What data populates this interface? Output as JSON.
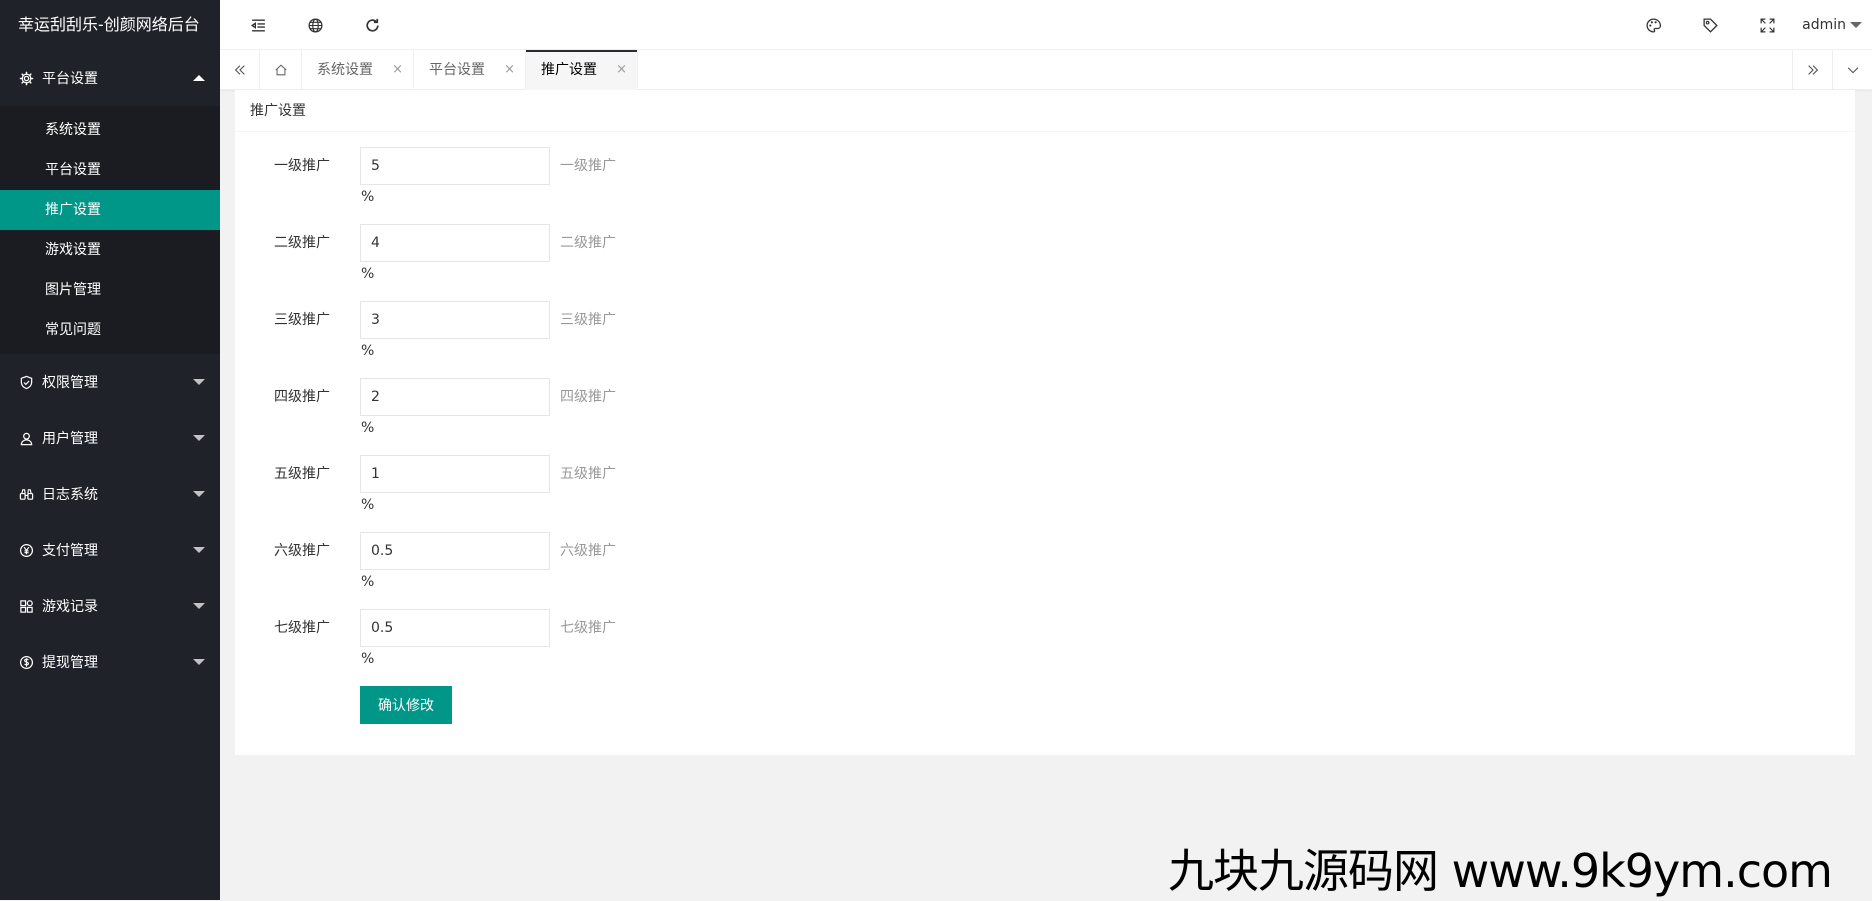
{
  "app_title": "幸运刮刮乐-创颜网络后台",
  "sidebar": {
    "groups": [
      {
        "label": "平台设置",
        "icon": "gear-icon",
        "expanded": true,
        "items": [
          {
            "label": "系统设置"
          },
          {
            "label": "平台设置"
          },
          {
            "label": "推广设置",
            "active": true
          },
          {
            "label": "游戏设置"
          },
          {
            "label": "图片管理"
          },
          {
            "label": "常见问题"
          }
        ]
      },
      {
        "label": "权限管理",
        "icon": "shield-icon"
      },
      {
        "label": "用户管理",
        "icon": "user-icon"
      },
      {
        "label": "日志系统",
        "icon": "binoculars-icon"
      },
      {
        "label": "支付管理",
        "icon": "yen-icon"
      },
      {
        "label": "游戏记录",
        "icon": "apps-icon"
      },
      {
        "label": "提现管理",
        "icon": "dollar-icon"
      }
    ]
  },
  "header": {
    "user": "admin"
  },
  "tabs": [
    {
      "label": "系统设置"
    },
    {
      "label": "平台设置"
    },
    {
      "label": "推广设置",
      "active": true
    }
  ],
  "tab_close_glyph": "×",
  "card": {
    "title": "推广设置",
    "fields": [
      {
        "label": "一级推广",
        "value": "5",
        "tip": "一级推广",
        "unit": "%"
      },
      {
        "label": "二级推广",
        "value": "4",
        "tip": "二级推广",
        "unit": "%"
      },
      {
        "label": "三级推广",
        "value": "3",
        "tip": "三级推广",
        "unit": "%"
      },
      {
        "label": "四级推广",
        "value": "2",
        "tip": "四级推广",
        "unit": "%"
      },
      {
        "label": "五级推广",
        "value": "1",
        "tip": "五级推广",
        "unit": "%"
      },
      {
        "label": "六级推广",
        "value": "0.5",
        "tip": "六级推广",
        "unit": "%"
      },
      {
        "label": "七级推广",
        "value": "0.5",
        "tip": "七级推广",
        "unit": "%"
      }
    ],
    "submit_label": "确认修改"
  },
  "watermark": "九块九源码网 www.9k9ym.com",
  "colors": {
    "accent": "#009688",
    "sidebar_bg": "#20222a",
    "sidebar_sub_bg": "#1a1c22"
  }
}
